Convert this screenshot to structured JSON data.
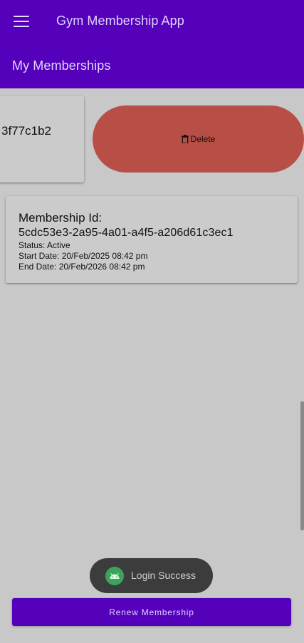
{
  "appbar": {
    "menu_icon": "hamburger-menu-icon",
    "title": "Gym Membership App",
    "page_title": "My Memberships",
    "color": "#5500bb"
  },
  "memberships": [
    {
      "id_fragment": "3f77c1b2",
      "delete_label": "Delete",
      "delete_icon": "trash-icon",
      "delete_color": "#b84f47"
    },
    {
      "heading": "Membership Id:",
      "id": "5cdc53e3-2a95-4a01-a4f5-a206d61c3ec1",
      "status": "Status: Active",
      "start_date": "Start Date: 20/Feb/2025 08:42 pm",
      "end_date": "End Date: 20/Feb/2026 08:42 pm"
    }
  ],
  "toast": {
    "icon": "android-icon",
    "text": "Login Success"
  },
  "renew_button": {
    "label": "Renew Membership"
  }
}
